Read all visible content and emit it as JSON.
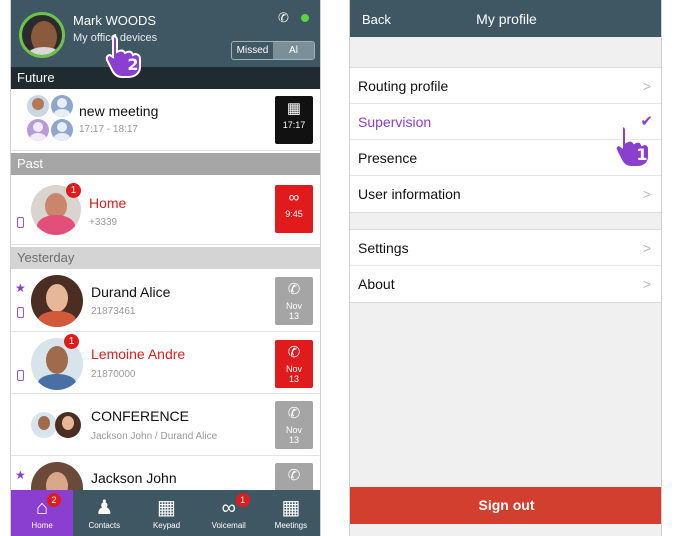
{
  "left": {
    "header": {
      "name": "Mark WOODS",
      "subtitle": "My office devices",
      "filter_missed": "Missed",
      "filter_all": "Al"
    },
    "sections": {
      "future": "Future",
      "past": "Past",
      "yesterday": "Yesterday"
    },
    "items": [
      {
        "title": "new meeting",
        "subtitle": "17:17 - 18:17",
        "tile": "17:17"
      },
      {
        "title": "Home",
        "subtitle": "+3339",
        "tile": "9:45",
        "badge": "1"
      },
      {
        "title": "Durand Alice",
        "subtitle": "21873461",
        "tile_l1": "Nov",
        "tile_l2": "13"
      },
      {
        "title": "Lemoine Andre",
        "subtitle": "21870000",
        "tile_l1": "Nov",
        "tile_l2": "13",
        "badge": "1"
      },
      {
        "title": "CONFERENCE",
        "subtitle": "Jackson John / Durand Alice",
        "tile_l1": "Nov",
        "tile_l2": "13"
      },
      {
        "title": "Jackson John"
      }
    ],
    "nav": [
      {
        "label": "Home",
        "badge": "2"
      },
      {
        "label": "Contacts"
      },
      {
        "label": "Keypad"
      },
      {
        "label": "Voicemail",
        "badge": "1"
      },
      {
        "label": "Meetings"
      }
    ],
    "hand_number": "2"
  },
  "right": {
    "header": {
      "back": "Back",
      "title": "My profile"
    },
    "group1": [
      "Routing profile",
      "Supervision",
      "Presence",
      "User information"
    ],
    "group2": [
      "Settings",
      "About"
    ],
    "sign_out": "Sign out",
    "hand_number": "1"
  },
  "colors": {
    "header": "#3f5763",
    "accent": "#8a3fd1",
    "alert": "#e11b1b",
    "sign_out": "#d33f2e",
    "online": "#5cd23d"
  }
}
